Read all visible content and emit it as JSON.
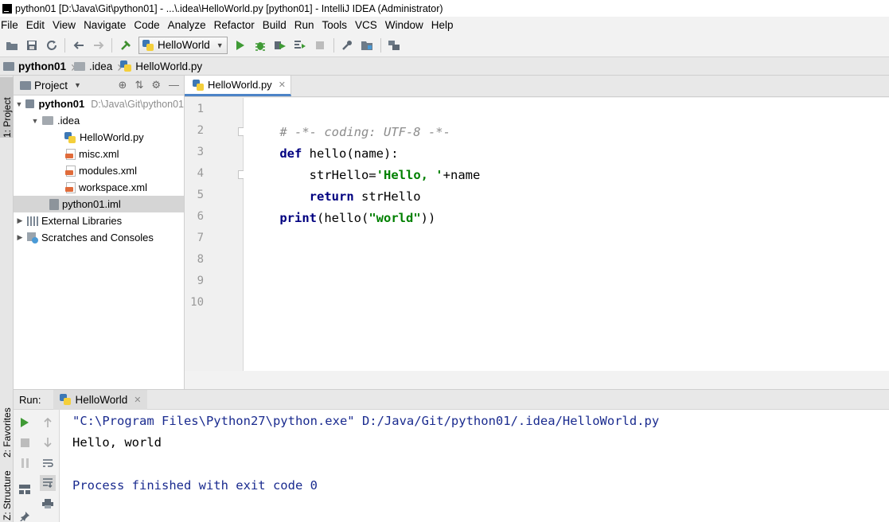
{
  "window": {
    "title": "python01 [D:\\Java\\Git\\python01] - ...\\.idea\\HelloWorld.py [python01] - IntelliJ IDEA (Administrator)"
  },
  "menu": [
    "File",
    "Edit",
    "View",
    "Navigate",
    "Code",
    "Analyze",
    "Refactor",
    "Build",
    "Run",
    "Tools",
    "VCS",
    "Window",
    "Help"
  ],
  "toolbar": {
    "run_config": "HelloWorld"
  },
  "breadcrumb": [
    "python01",
    ".idea",
    "HelloWorld.py"
  ],
  "side_tabs": {
    "project": "1: Project",
    "favorites": "2: Favorites",
    "structure": "Z: Structure"
  },
  "project_panel": {
    "title": "Project",
    "root": {
      "name": "python01",
      "path": "D:\\Java\\Git\\python01"
    },
    "items": [
      {
        "name": ".idea"
      },
      {
        "name": "HelloWorld.py"
      },
      {
        "name": "misc.xml"
      },
      {
        "name": "modules.xml"
      },
      {
        "name": "workspace.xml"
      },
      {
        "name": "python01.iml"
      },
      {
        "name": "External Libraries"
      },
      {
        "name": "Scratches and Consoles"
      }
    ]
  },
  "editor": {
    "tab": "HelloWorld.py",
    "line_numbers": [
      "1",
      "2",
      "3",
      "4",
      "5",
      "6",
      "7",
      "8",
      "9",
      "10"
    ],
    "code": {
      "l1": "# -*- coding: UTF-8 -*-",
      "l2_kw": "def",
      "l2_rest": " hello(name):",
      "l3_a": "    strHello=",
      "l3_str": "'Hello, '",
      "l3_b": "+name",
      "l4_indent": "    ",
      "l4_kw": "return",
      "l4_rest": " strHello",
      "l5_kw": "print",
      "l5_a": "(hello(",
      "l5_str": "\"world\"",
      "l5_b": "))"
    },
    "current_line": 7
  },
  "run_panel": {
    "label": "Run:",
    "tab": "HelloWorld",
    "console": [
      "\"C:\\Program Files\\Python27\\python.exe\" D:/Java/Git/python01/.idea/HelloWorld.py",
      "Hello, world",
      "",
      "Process finished with exit code 0"
    ]
  },
  "colors": {
    "keyword": "#000080",
    "string": "#008000",
    "comment": "#8c8c8c",
    "console_system": "#1a2b8f"
  }
}
